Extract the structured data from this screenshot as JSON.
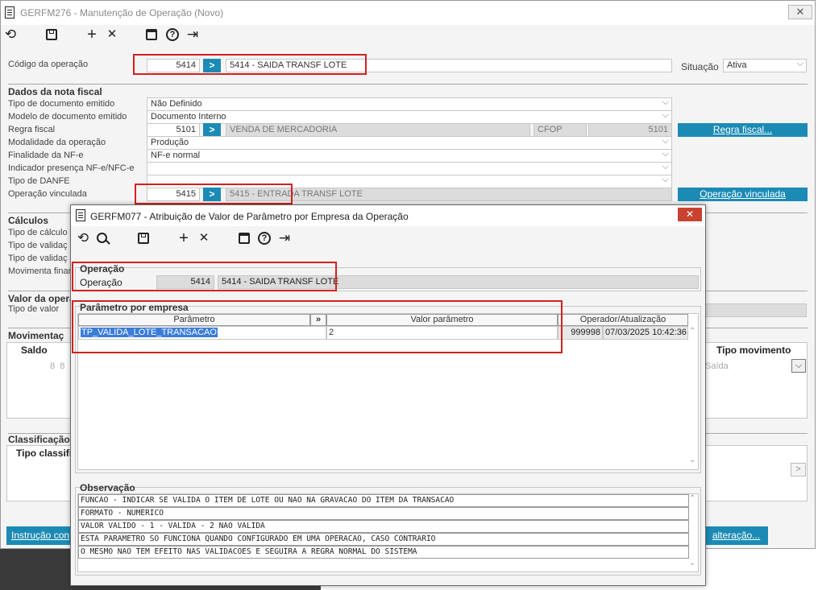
{
  "main": {
    "title": "GERFM276 - Manutenção de Operação (Novo)",
    "close": "✕",
    "codigo_label": "Código da operação",
    "codigo_value": "5414",
    "codigo_desc": "5414 - SAIDA TRANSF LOTE",
    "situacao_label": "Situação",
    "situacao_value": "Ativa",
    "dados_title": "Dados da nota fiscal",
    "tipo_doc_label": "Tipo de documento emitido",
    "tipo_doc_value": "Não Definido",
    "modelo_label": "Modelo de documento emitido",
    "modelo_value": "Documento Interno",
    "regra_label": "Regra fiscal",
    "regra_value": "5101",
    "regra_desc": "VENDA DE MERCADORIA",
    "cfop_label": "CFOP",
    "cfop_value": "5101",
    "regra_btn": "Regra fiscal...",
    "modalidade_label": "Modalidade da operação",
    "modalidade_value": "Produção",
    "finalidade_label": "Finalidade da NF-e",
    "finalidade_value": "NF-e normal",
    "indicador_label": "Indicador presença NF-e/NFC-e",
    "danfe_label": "Tipo de DANFE",
    "vinculada_label": "Operação vinculada",
    "vinculada_value": "5415",
    "vinculada_desc": "5415 - ENTRADA TRANSF LOTE",
    "vinculada_btn": "Operação vinculada",
    "calculos_title": "Cálculos",
    "calc1": "Tipo de cálculo d",
    "calc2": "Tipo de validaç",
    "calc3": "Tipo de validaç",
    "calc4": "Movimenta finan",
    "valor_title": "Valor da opera",
    "tipo_valor_label": "Tipo de valor",
    "mov_title": "Movimentaç",
    "saldo_header": "Saldo",
    "saldo_value": "8  8",
    "tipo_mov_header": "Tipo movimento",
    "tipo_mov_value": "Saída",
    "class_title": "Classificação d",
    "tipo_class_header": "Tipo classifi",
    "instrucao_btn": "Instrução con",
    "alteracao_btn": "alteração..."
  },
  "dialog": {
    "title": "GERFM077 - Atribuição de Valor de Parâmetro por Empresa da Operação",
    "close": "✕",
    "operacao_section": "Operação",
    "operacao_label": "Operação",
    "operacao_value": "5414",
    "operacao_desc": "5414 - SAIDA TRANSF LOTE",
    "param_section": "Parâmetro por empresa",
    "col_parametro": "Parâmetro",
    "col_expand": "»",
    "col_valor": "Valor parâmetro",
    "col_operador": "Operador/Atualização",
    "row": {
      "parametro": "TP_VALIDA_LOTE_TRANSACAO",
      "valor": "2",
      "operador": "999998",
      "atualizacao": "07/03/2025 10:42:36"
    },
    "obs_section": "Observação",
    "obs_lines": [
      "FUNCAO - INDICAR SE VALIDA O ITEM DE LOTE OU NAO NA GRAVACAO DO ITEM DA TRANSACAO",
      "FORMATO - NUMERICO",
      "VALOR VALIDO - 1 - VALIDA - 2 NAO VALIDA",
      "ESTA PARAMETRO SO FUNCIONA QUANDO CONFIGURADO EM UMA OPERACAO, CASO CONTRARIO",
      "O MESMO NAO TEM EFEITO NAS VALIDACOES E SEGUIRA A REGRA NORMAL DO SISTEMA"
    ]
  },
  "icons": {
    "undo": "⟲",
    "search": "⌕",
    "save": "💾",
    "add": "+",
    "remove": "✕",
    "calendar": "📅",
    "help": "?",
    "exit": "⇥",
    "go": ">"
  },
  "colors": {
    "accent": "#1b8bb5",
    "highlight": "#d42020",
    "selection": "#3b7dd8"
  }
}
